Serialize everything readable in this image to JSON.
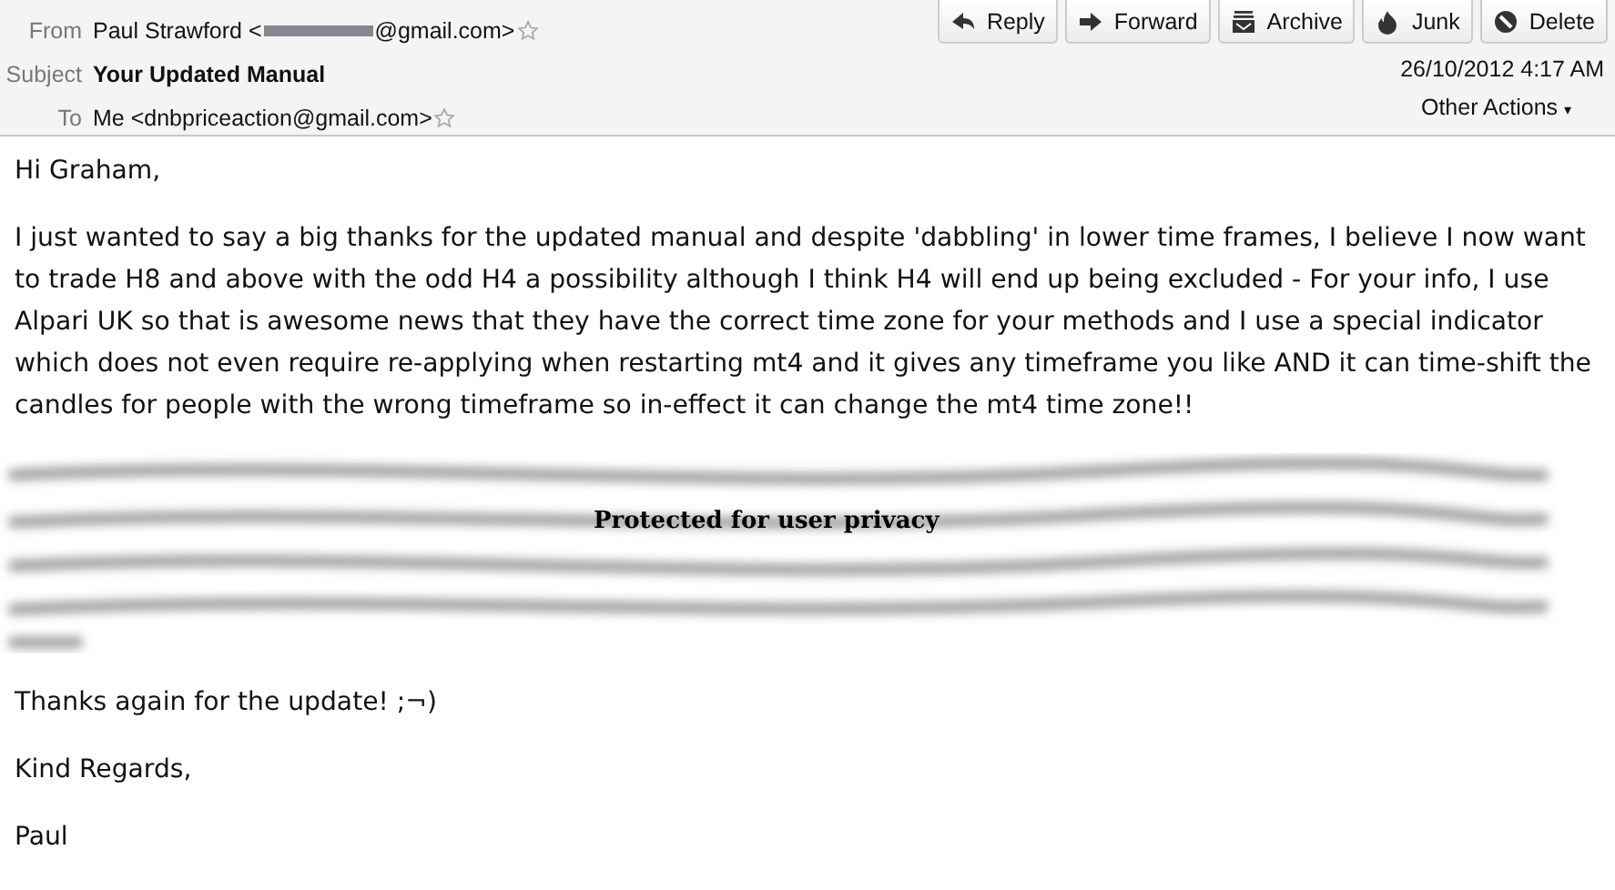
{
  "header": {
    "fields": [
      {
        "kind": "from",
        "label": "From",
        "value_start": "Paul Strawford <",
        "value_end": "@gmail.com>",
        "redacted": true
      },
      {
        "kind": "subject",
        "label": "Subject",
        "value_start": "Your Updated Manual",
        "redacted": false
      },
      {
        "kind": "to",
        "label": "To",
        "value_start": "Me <dnbpriceaction@gmail.com>",
        "redacted": false
      }
    ],
    "buttons": [
      {
        "kind": "reply",
        "label": "Reply"
      },
      {
        "kind": "forward",
        "label": "Forward"
      },
      {
        "kind": "archive",
        "label": "Archive"
      },
      {
        "kind": "junk",
        "label": "Junk"
      },
      {
        "kind": "delete",
        "label": "Delete"
      }
    ],
    "date": "26/10/2012 4:17 AM",
    "other_actions": "Other Actions",
    "other_actions_caret": "▾"
  },
  "body": {
    "paragraphs": [
      {
        "kind": "text",
        "text": "Hi Graham,"
      },
      {
        "kind": "text",
        "text": "I just wanted to say a big thanks for the updated manual and despite 'dabbling' in lower time frames, I believe I now want to trade H8 and above with the odd H4 a possibility although I think H4 will end up being excluded - For your info, I use Alpari UK so that is awesome news that they have the correct time zone for your methods and I use a special indicator which does not even require re-applying when restarting mt4 and it gives any timeframe you like AND it can time-shift the candles for people with the wrong timeframe so in-effect it can change the mt4 time zone!!"
      },
      {
        "kind": "redacted",
        "text": "Protected for user privacy"
      },
      {
        "kind": "text",
        "text": "Thanks again for the update! ;¬)"
      },
      {
        "kind": "text",
        "text": "Kind Regards,"
      },
      {
        "kind": "text",
        "text": "Paul"
      }
    ]
  }
}
